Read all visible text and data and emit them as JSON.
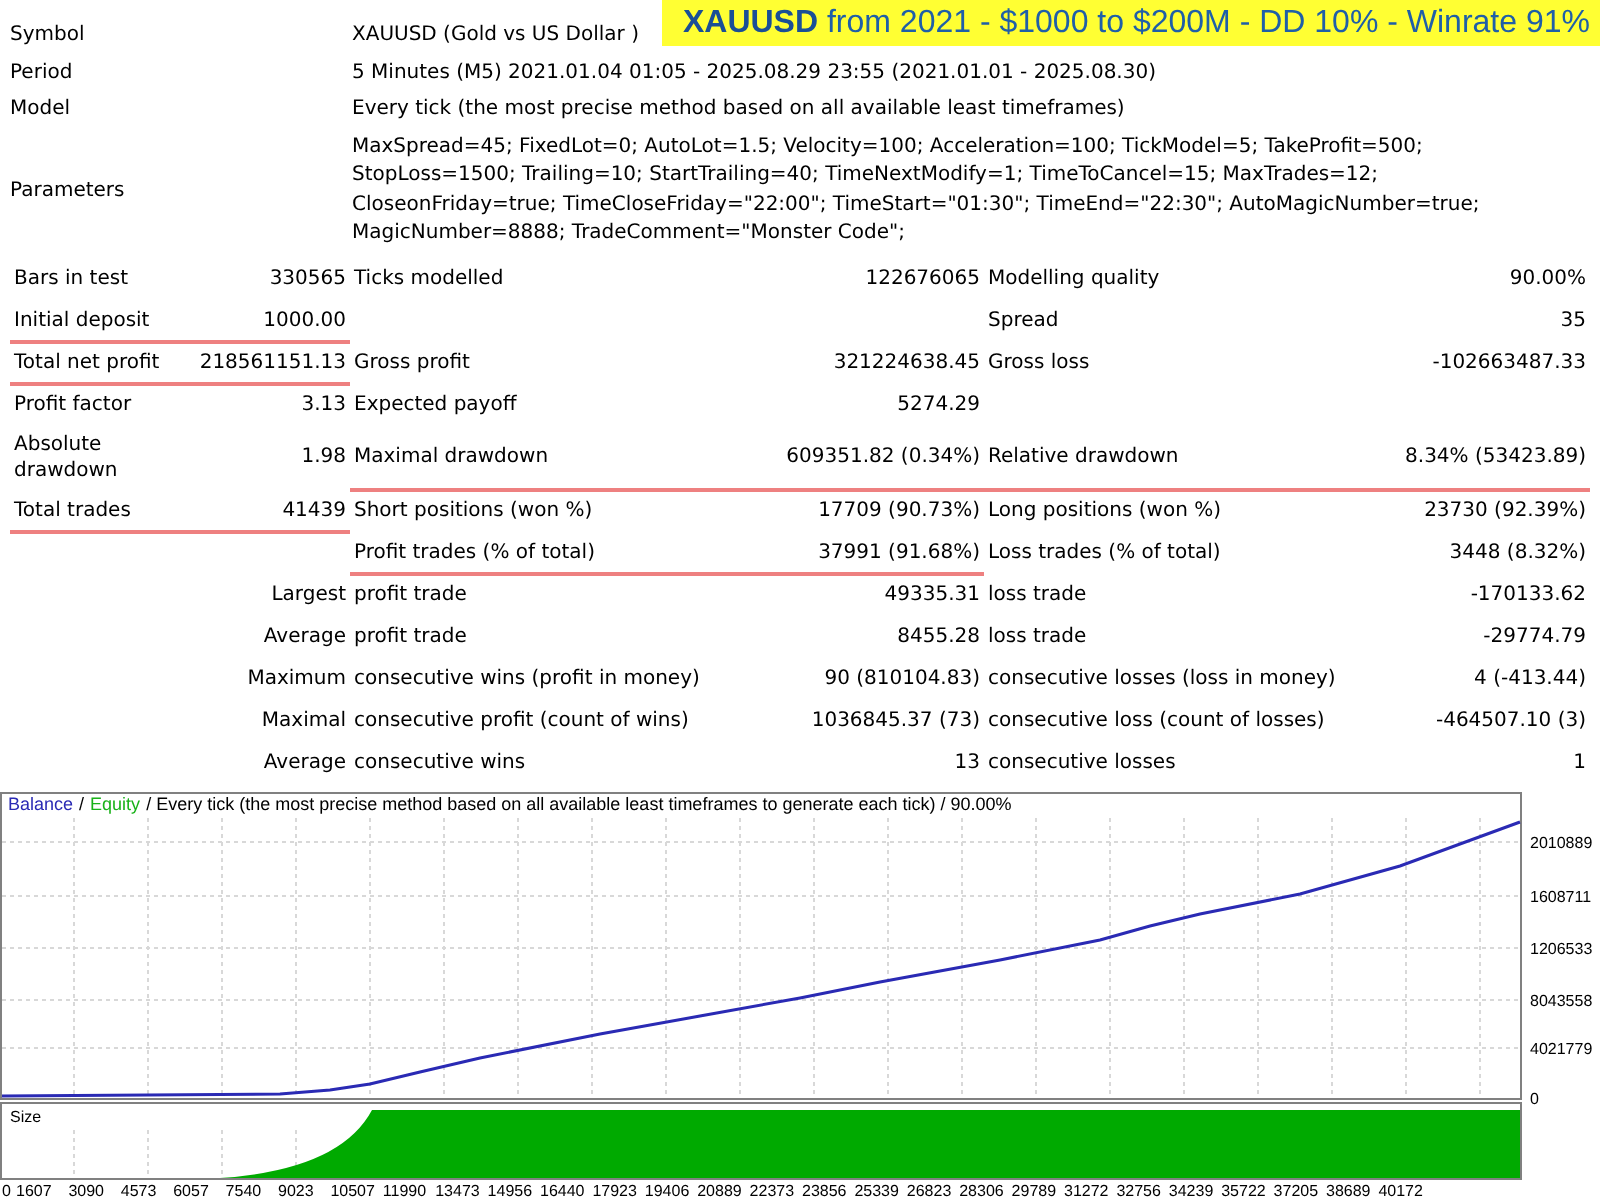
{
  "banner": "**XAUUSD** from 2021 - $1000 to $200M - DD 10% - Winrate 91%",
  "summary": [
    {
      "label": "Symbol",
      "value": "XAUUSD (Gold vs US Dollar )"
    },
    {
      "label": "Period",
      "value": "5 Minutes (M5) 2021.01.04 01:05 - 2025.08.29 23:55 (2021.01.01 - 2025.08.30)"
    },
    {
      "label": "Model",
      "value": "Every tick (the most precise method based on all available least timeframes)"
    },
    {
      "label": "Parameters",
      "value": "MaxSpread=45; FixedLot=0; AutoLot=1.5; Velocity=100; Acceleration=100; TickModel=5; TakeProfit=500; StopLoss=1500; Trailing=10; StartTrailing=40; TimeNextModify=1; TimeToCancel=15; MaxTrades=12; CloseonFriday=true; TimeCloseFriday=\"22:00\"; TimeStart=\"01:30\"; TimeEnd=\"22:30\"; AutoMagicNumber=true; MagicNumber=8888; TradeComment=\"Monster Code\";"
    }
  ],
  "stats": [
    {
      "kind": "pairs",
      "left": {
        "label": "Bars in test",
        "value": "330565",
        "underlined": false
      },
      "middle": {
        "label": "Ticks modelled",
        "value": "122676065",
        "underlined": false
      },
      "right": {
        "label": "Modelling quality",
        "value": "90.00%",
        "underlined": false
      }
    },
    {
      "kind": "pairs",
      "left": {
        "label": "Initial deposit",
        "value": "1000.00",
        "underlined": true
      },
      "right": {
        "label": "Spread",
        "value": "35",
        "underlined": false
      }
    },
    {
      "kind": "pairs",
      "left": {
        "label": "Total net profit",
        "value": "218561151.13",
        "underlined": true
      },
      "middle": {
        "label": "Gross profit",
        "value": "321224638.45",
        "underlined": false
      },
      "right": {
        "label": "Gross loss",
        "value": "-102663487.33",
        "underlined": false
      }
    },
    {
      "kind": "pairs",
      "left": {
        "label": "Profit factor",
        "value": "3.13",
        "underlined": false
      },
      "middle": {
        "label": "Expected payoff",
        "value": "5274.29",
        "underlined": false
      }
    },
    {
      "kind": "pairs",
      "left": {
        "label": "Absolute drawdown",
        "value": "1.98",
        "underlined": false
      },
      "middle": {
        "label": "Maximal drawdown",
        "value": "609351.82 (0.34%)",
        "underlined": true
      },
      "right": {
        "label": "Relative drawdown",
        "value": "8.34% (53423.89)",
        "underlined": true
      }
    },
    {
      "kind": "pairs",
      "left": {
        "label": "Total trades",
        "value": "41439",
        "underlined": true
      },
      "middle": {
        "label": "Short positions (won %)",
        "value": "17709 (90.73%)",
        "underlined": false
      },
      "right": {
        "label": "Long positions (won %)",
        "value": "23730 (92.39%)",
        "underlined": false
      }
    },
    {
      "kind": "pairs",
      "middle": {
        "label": "Profit trades (% of total)",
        "value": "37991 (91.68%)",
        "underlined": true
      },
      "right": {
        "label": "Loss trades (% of total)",
        "value": "3448 (8.32%)",
        "underlined": false
      }
    },
    {
      "kind": "group",
      "heading": "Largest",
      "middle": {
        "label": "profit trade",
        "value": "49335.31",
        "underlined": false
      },
      "right": {
        "label": "loss trade",
        "value": "-170133.62",
        "underlined": false
      }
    },
    {
      "kind": "group",
      "heading": "Average",
      "middle": {
        "label": "profit trade",
        "value": "8455.28",
        "underlined": false
      },
      "right": {
        "label": "loss trade",
        "value": "-29774.79",
        "underlined": false
      }
    },
    {
      "kind": "group",
      "heading": "Maximum",
      "middle": {
        "label": "consecutive wins (profit in money)",
        "value": "90 (810104.83)",
        "underlined": false
      },
      "right": {
        "label": "consecutive losses (loss in money)",
        "value": "4 (-413.44)",
        "underlined": false
      }
    },
    {
      "kind": "group",
      "heading": "Maximal",
      "middle": {
        "label": "consecutive profit (count of wins)",
        "value": "1036845.37 (73)",
        "underlined": false
      },
      "right": {
        "label": "consecutive loss (count of losses)",
        "value": "-464507.10 (3)",
        "underlined": false
      }
    },
    {
      "kind": "group",
      "heading": "Average",
      "middle": {
        "label": "consecutive wins",
        "value": "13",
        "underlined": false
      },
      "right": {
        "label": "consecutive losses",
        "value": "1",
        "underlined": false
      }
    }
  ],
  "chart": {
    "legend": [
      {
        "text": "Balance",
        "color": "#2a2ab4"
      },
      {
        "text": "/",
        "color": "#000000"
      },
      {
        "text": "Equity",
        "color": "#19b219"
      },
      {
        "text": "/ Every tick (the most precise method based on all available least timeframes to generate each tick) / 90.00%",
        "color": "#000000"
      }
    ],
    "y_labels": [
      "2010889",
      "1608711",
      "1206533",
      "8043558",
      "4021779",
      "0"
    ],
    "size_label": "Size",
    "x_labels": [
      "0",
      "1607",
      "3090",
      "4573",
      "6057",
      "7540",
      "9023",
      "10507",
      "11990",
      "13473",
      "14956",
      "16440",
      "17923",
      "19406",
      "20889",
      "22373",
      "23856",
      "25339",
      "26823",
      "28306",
      "29789",
      "31272",
      "32756",
      "34239",
      "35722",
      "37205",
      "38689",
      "40172"
    ]
  }
}
